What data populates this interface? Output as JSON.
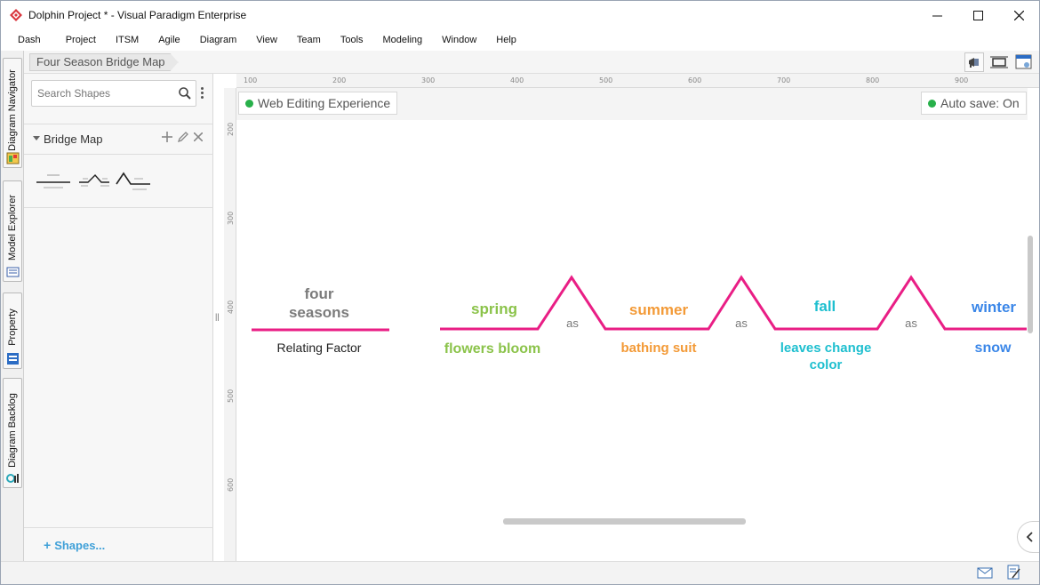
{
  "window": {
    "title": "Dolphin Project * - Visual Paradigm Enterprise"
  },
  "menu": [
    "Dash",
    "Project",
    "ITSM",
    "Agile",
    "Diagram",
    "View",
    "Team",
    "Tools",
    "Modeling",
    "Window",
    "Help"
  ],
  "side_tabs": [
    "Diagram Navigator",
    "Model Explorer",
    "Property",
    "Diagram Backlog"
  ],
  "breadcrumb": "Four Season Bridge Map",
  "left_panel": {
    "search_placeholder": "Search Shapes",
    "section_title": "Bridge Map",
    "shapes_link": "Shapes..."
  },
  "canvas": {
    "status_left": "Web Editing Experience",
    "status_right": "Auto save: On",
    "ruler_top": [
      "100",
      "200",
      "300",
      "400",
      "500",
      "600",
      "700",
      "800",
      "900"
    ],
    "ruler_left": [
      "200",
      "300",
      "400",
      "500",
      "600"
    ]
  },
  "colors": {
    "accent": "#e91e85",
    "status_green": "#28b04a",
    "link_blue": "#3fa0d8"
  },
  "bridge_map": {
    "factor_top": "four seasons",
    "factor_bottom": "Relating Factor",
    "relation_word": "as",
    "pairs": [
      {
        "top": "spring",
        "bottom": "flowers bloom",
        "color": "#8bc34a"
      },
      {
        "top": "summer",
        "bottom": "bathing suit",
        "color": "#f39a37"
      },
      {
        "top": "fall",
        "bottom": "leaves change color",
        "color": "#1ebfcf"
      },
      {
        "top": "winter",
        "bottom": "snow",
        "color": "#3a86e8"
      }
    ]
  }
}
